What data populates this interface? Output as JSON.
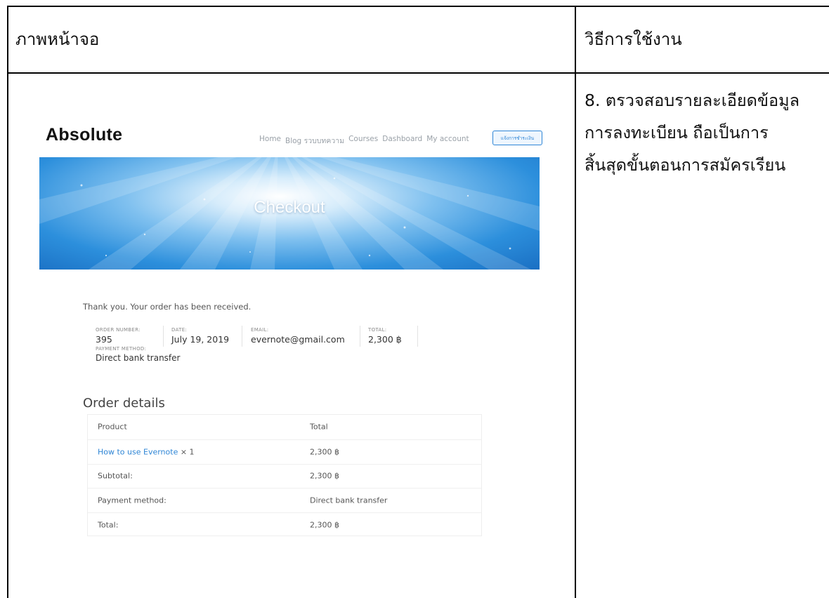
{
  "doc": {
    "header_left": "ภาพหน้าจอ",
    "header_right": "วิธีการใช้งาน",
    "instruction_lines": [
      "8. ตรวจสอบรายละเอียดข้อมูล",
      "การลงทะเบียน ถือเป็นการ",
      "สิ้นสุดขั้นตอนการสมัครเรียน"
    ]
  },
  "site": {
    "brand": "Absolute",
    "nav": [
      "Home",
      "Blog รวบบทความ",
      "Courses",
      "Dashboard",
      "My account"
    ],
    "nav_button": "แจ้งการชำระเงิน",
    "hero_title": "Checkout",
    "thanks_message": "Thank you. Your order has been received.",
    "overview": {
      "order_number_label": "ORDER NUMBER:",
      "order_number": "395",
      "date_label": "DATE:",
      "date": "July 19, 2019",
      "email_label": "EMAIL:",
      "email": "evernote@gmail.com",
      "total_label": "TOTAL:",
      "total": "2,300 ฿",
      "payment_method_label": "PAYMENT METHOD:",
      "payment_method": "Direct bank transfer"
    },
    "order_details": {
      "title": "Order details",
      "header": [
        "Product",
        "Total"
      ],
      "item_name": "How to use Evernote",
      "item_qty": "× 1",
      "item_total": "2,300 ฿",
      "subtotal_label": "Subtotal:",
      "subtotal": "2,300 ฿",
      "payment_label": "Payment method:",
      "payment": "Direct bank transfer",
      "total_label": "Total:",
      "total": "2,300 ฿"
    }
  },
  "colors": {
    "accent": "#2f86d6",
    "hero_dark": "#1a6fc3",
    "hero_light": "#d6ecfb"
  }
}
